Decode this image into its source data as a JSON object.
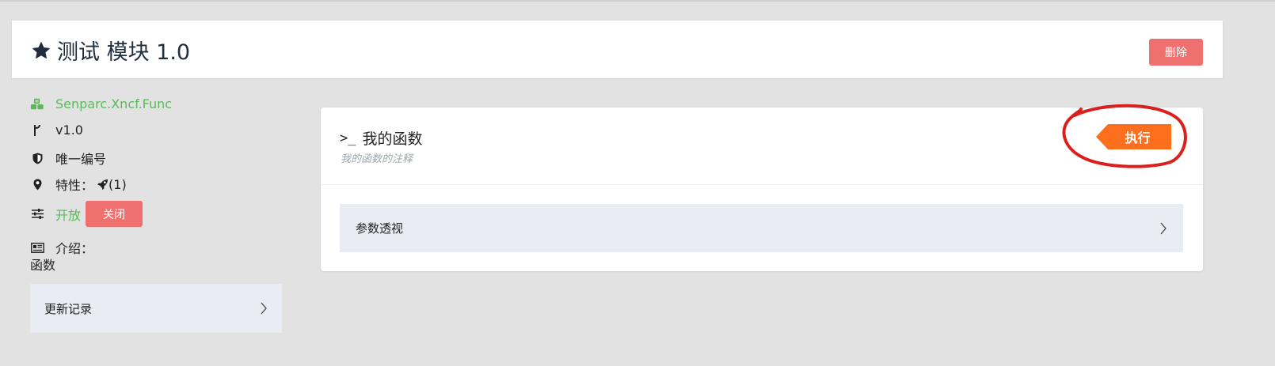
{
  "header": {
    "title": "测试 模块 1.0",
    "delete_label": "删除"
  },
  "sidebar": {
    "module_name": "Senparc.Xncf.Func",
    "version": "v1.0",
    "unique_id_label": "唯一编号",
    "features_label": "特性：",
    "features_value": "(1)",
    "status_open": "开放",
    "close_button": "关闭",
    "intro_label": "介绍：",
    "intro_value": "函数",
    "changelog_label": "更新记录"
  },
  "function": {
    "prompt": ">_",
    "name": "我的函数",
    "note": "我的函数的注释",
    "execute_label": "执行",
    "params_label": "参数透视"
  },
  "icons": {
    "title": "star-icon",
    "module": "cubes-icon",
    "version": "branch-icon",
    "id": "shield-icon",
    "features": "map-marker-icon",
    "feature_item": "rocket-icon",
    "status": "sliders-icon",
    "intro": "newspaper-icon",
    "expand": "chevron-right-icon"
  },
  "colors": {
    "danger": "#f0706f",
    "execute": "#fd6f1c",
    "success": "#5cb85c",
    "annotation": "#d9201c",
    "panel": "#e9ecf3"
  }
}
